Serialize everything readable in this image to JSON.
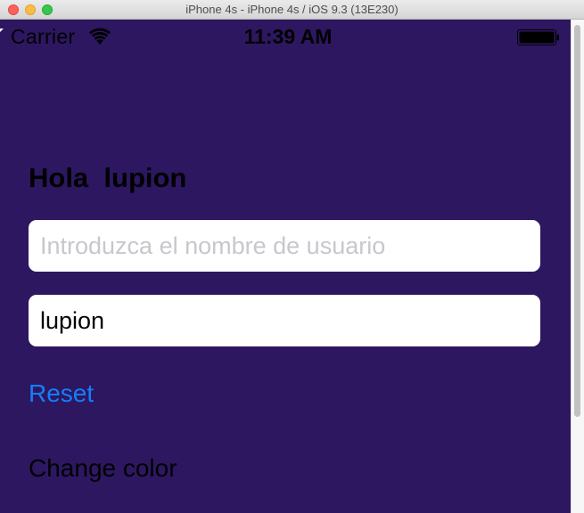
{
  "window": {
    "title": "iPhone 4s - iPhone 4s / iOS 9.3 (13E230)"
  },
  "statusbar": {
    "carrier": "Carrier",
    "time": "11:39 AM",
    "wifi_icon": "wifi-icon",
    "battery_icon": "battery-icon"
  },
  "app": {
    "greeting": "Hola  lupion",
    "username_placeholder": "Introduzca el nombre de usuario",
    "username_value": "",
    "name_value": "lupion",
    "reset_label": "Reset",
    "change_color_label": "Change color"
  },
  "colors": {
    "background": "#2d1760",
    "accent": "#157efb",
    "field": "#ffffff"
  }
}
